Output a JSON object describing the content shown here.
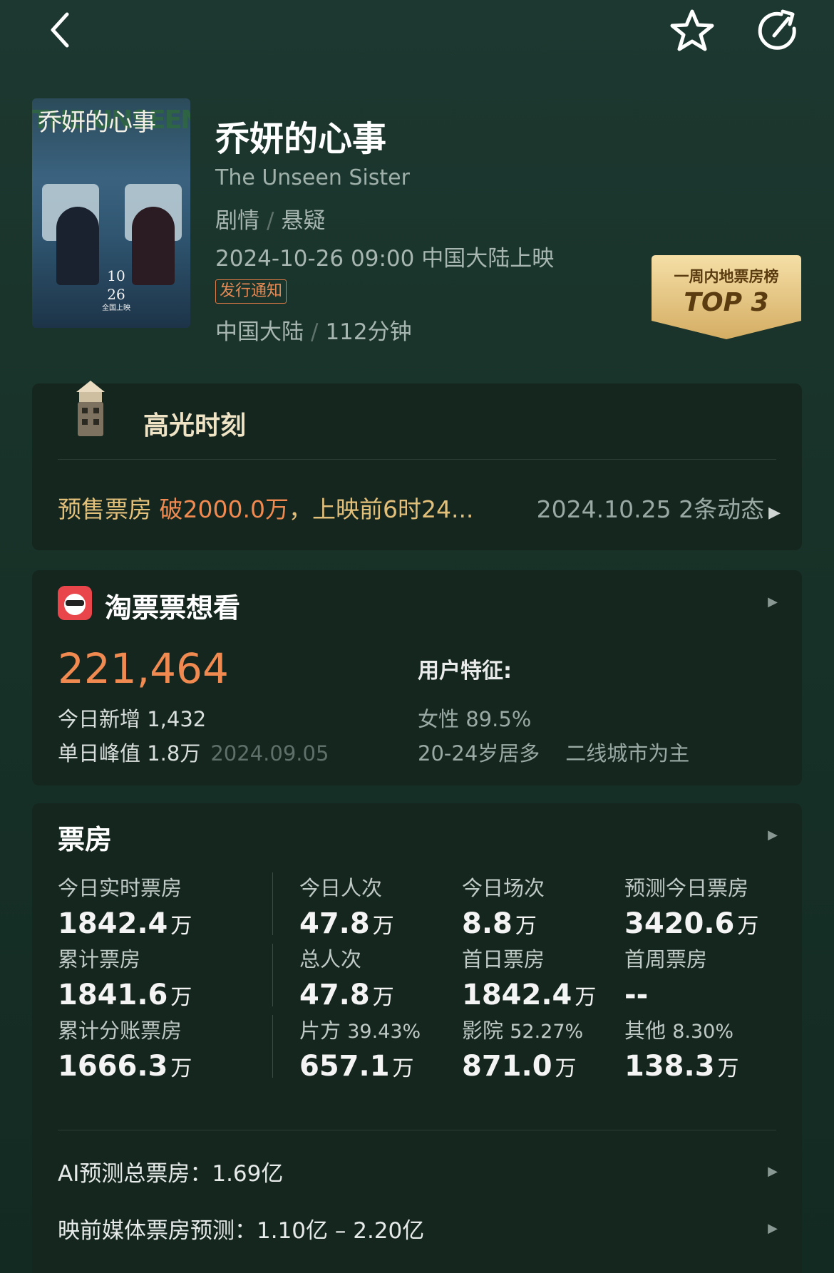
{
  "movie": {
    "title": "乔妍的心事",
    "english_title": "The Unseen Sister",
    "genres": [
      "剧情",
      "悬疑"
    ],
    "release": "2024-10-26 09:00 中国大陆上映",
    "notice": "发行通知",
    "region": "中国大陆",
    "duration": "112分钟",
    "poster": {
      "title": "乔妍的心事",
      "bg_title": "THE UNSEEN SISTER",
      "date_month": "10",
      "date_day": "26",
      "date_caption": "全国上映"
    }
  },
  "rank_badge": {
    "label": "一周内地票房榜",
    "rank": "TOP 3"
  },
  "highlights": {
    "title": "高光时刻",
    "news_prefix": "预售票房 ",
    "news_highlight": "破2000.0万",
    "news_suffix": "，上映前6时24...",
    "date": "2024.10.25",
    "count": "2条动态"
  },
  "want": {
    "title": "淘票票想看",
    "total": "221,464",
    "today_new_label": "今日新增",
    "today_new": "1,432",
    "peak_label": "单日峰值",
    "peak": "1.8万",
    "peak_date": "2024.09.05",
    "user_label": "用户特征:",
    "female": "女性 89.5%",
    "age": "20-24岁居多",
    "city": "二线城市为主"
  },
  "box_office": {
    "title": "票房",
    "unit": "万",
    "rows": [
      [
        {
          "label": "今日实时票房",
          "value": "1842.4",
          "unit": "万"
        },
        {
          "label": "今日人次",
          "value": "47.8",
          "unit": "万"
        },
        {
          "label": "今日场次",
          "value": "8.8",
          "unit": "万"
        },
        {
          "label": "预测今日票房",
          "value": "3420.6",
          "unit": "万"
        }
      ],
      [
        {
          "label": "累计票房",
          "value": "1841.6",
          "unit": "万"
        },
        {
          "label": "总人次",
          "value": "47.8",
          "unit": "万"
        },
        {
          "label": "首日票房",
          "value": "1842.4",
          "unit": "万"
        },
        {
          "label": "首周票房",
          "value": "--",
          "unit": ""
        }
      ],
      [
        {
          "label": "累计分账票房",
          "pct": "",
          "value": "1666.3",
          "unit": "万"
        },
        {
          "label": "片方",
          "pct": "39.43%",
          "value": "657.1",
          "unit": "万"
        },
        {
          "label": "影院",
          "pct": "52.27%",
          "value": "871.0",
          "unit": "万"
        },
        {
          "label": "其他",
          "pct": "8.30%",
          "value": "138.3",
          "unit": "万"
        }
      ]
    ],
    "ai_forecast": "AI预测总票房：1.69亿",
    "media_forecast": "映前媒体票房预测：1.10亿 – 2.20亿"
  },
  "icons": {
    "back": "chevron-left-icon",
    "favorite": "star-icon",
    "share": "share-icon",
    "highlight": "film-lighthouse-icon",
    "taopiaopiao": "taopiaopiao-logo-icon"
  },
  "colors": {
    "accent_orange": "#f08a50",
    "gold": "#d9b46a",
    "background": "#183229"
  }
}
